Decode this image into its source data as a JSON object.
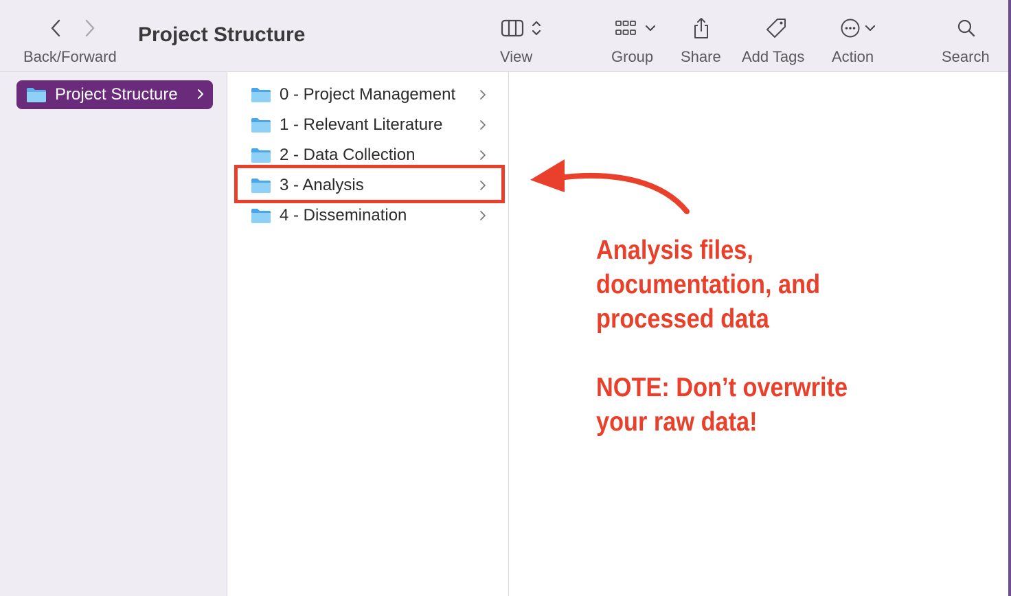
{
  "window": {
    "title": "Project Structure"
  },
  "toolbar": {
    "back_forward_label": "Back/Forward",
    "view_label": "View",
    "group_label": "Group",
    "share_label": "Share",
    "add_tags_label": "Add Tags",
    "action_label": "Action",
    "search_label": "Search"
  },
  "sidebar": {
    "items": [
      {
        "label": "Project Structure",
        "selected": true
      }
    ]
  },
  "column": {
    "items": [
      {
        "label": "0 - Project Management"
      },
      {
        "label": "1 - Relevant Literature"
      },
      {
        "label": "2 - Data Collection"
      },
      {
        "label": "3 - Analysis",
        "highlighted": true
      },
      {
        "label": "4 - Dissemination"
      }
    ]
  },
  "annotation": {
    "line1": "Analysis files,",
    "line2": "documentation, and",
    "line3": "processed data",
    "line4": "NOTE: Don’t overwrite",
    "line5": "your raw data!"
  },
  "colors": {
    "accent": "#6a2c7a",
    "annotation": "#e8402a",
    "folder": "#5fb3ea",
    "toolbar_bg": "#efedf3"
  },
  "icons": {
    "back": "chevron-left-icon",
    "forward": "chevron-right-icon",
    "view": "columns-view-icon",
    "group": "grid-group-icon",
    "share": "share-icon",
    "tags": "tag-icon",
    "action": "ellipsis-circle-icon",
    "search": "search-icon",
    "folder": "folder-icon"
  }
}
